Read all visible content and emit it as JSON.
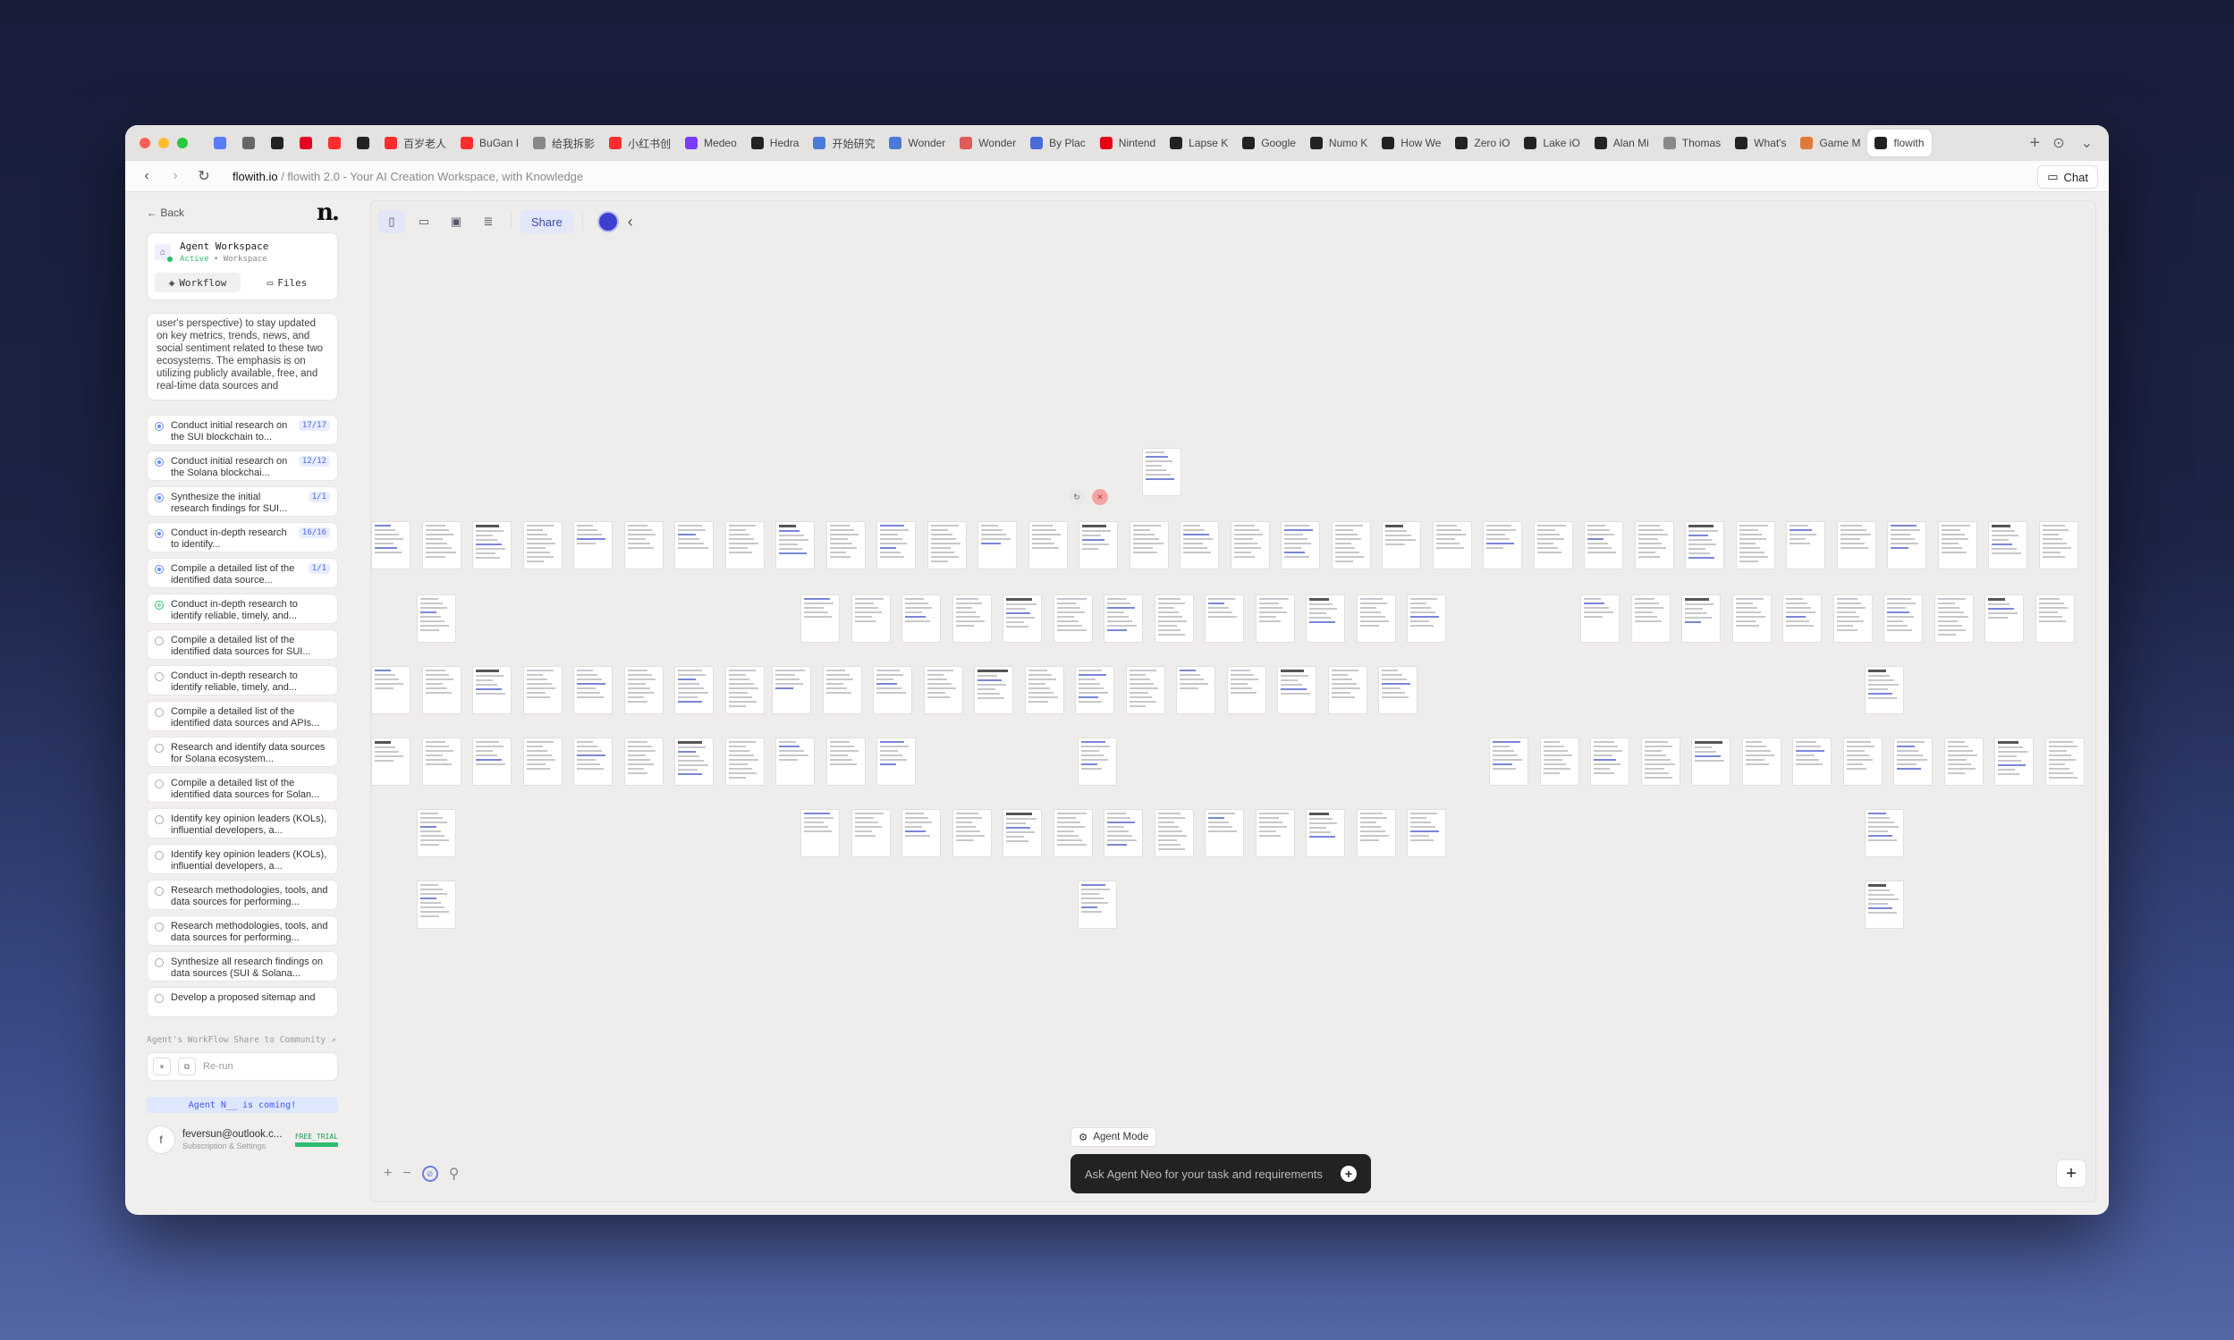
{
  "browser": {
    "tabs": [
      {
        "label": "",
        "icon": "sparkle-icon",
        "color": "#5a7cff"
      },
      {
        "label": "",
        "icon": "link-icon",
        "color": "#666666"
      },
      {
        "label": "",
        "icon": "cloud-icon",
        "color": "#222222"
      },
      {
        "label": "",
        "icon": "pinterest-icon",
        "color": "#e60023"
      },
      {
        "label": "",
        "icon": "youtube-icon",
        "color": "#ff2d2d"
      },
      {
        "label": "",
        "icon": "circle-icon",
        "color": "#222222"
      },
      {
        "label": "百岁老人",
        "icon": "youtube-icon",
        "color": "#ff2d2d"
      },
      {
        "label": "BuGan I",
        "icon": "youtube-icon",
        "color": "#ff2d2d"
      },
      {
        "label": "给我拆影",
        "icon": "chat-icon",
        "color": "#888888"
      },
      {
        "label": "小红书创",
        "icon": "youtube-icon",
        "color": "#ff2d2d"
      },
      {
        "label": "Medeo",
        "icon": "medeo-icon",
        "color": "#7a3cff"
      },
      {
        "label": "Hedra",
        "icon": "hedra-icon",
        "color": "#222222"
      },
      {
        "label": "开始研究",
        "icon": "doc-icon",
        "color": "#4a7bd8"
      },
      {
        "label": "Wonder",
        "icon": "doc-icon",
        "color": "#4a7bd8"
      },
      {
        "label": "Wonder",
        "icon": "w-icon",
        "color": "#e05a5a"
      },
      {
        "label": "By Plac",
        "icon": "bp-icon",
        "color": "#4a6cd8"
      },
      {
        "label": "Nintend",
        "icon": "nintendo-icon",
        "color": "#e60012"
      },
      {
        "label": "Lapse K",
        "icon": "cloud-icon",
        "color": "#222222"
      },
      {
        "label": "Google",
        "icon": "cloud-icon",
        "color": "#222222"
      },
      {
        "label": "Numo K",
        "icon": "cloud-icon",
        "color": "#222222"
      },
      {
        "label": "How We",
        "icon": "cloud-icon",
        "color": "#222222"
      },
      {
        "label": "Zero iO",
        "icon": "cloud-icon",
        "color": "#222222"
      },
      {
        "label": "Lake iO",
        "icon": "cloud-icon",
        "color": "#222222"
      },
      {
        "label": "Alan Mi",
        "icon": "cloud-icon",
        "color": "#222222"
      },
      {
        "label": "Thomas",
        "icon": "globe-icon",
        "color": "#888888"
      },
      {
        "label": "What's",
        "icon": "nyt-icon",
        "color": "#222222"
      },
      {
        "label": "Game M",
        "icon": "game-icon",
        "color": "#e07a3a"
      },
      {
        "label": "flowith",
        "icon": "flowith-icon",
        "color": "#222222",
        "active": true
      }
    ],
    "url_host": "flowith.io",
    "url_rest": " / flowith 2.0 - Your AI Creation Workspace, with Knowledge",
    "chat_label": "Chat"
  },
  "sidebar": {
    "back_label": "Back",
    "logo": "n.",
    "workspace_title": "Agent Workspace",
    "workspace_status_active": "Active",
    "workspace_status_rest": " • Workspace",
    "tab_workflow": "Workflow",
    "tab_files": "Files",
    "prompt_text": "user's perspective) to stay updated on key metrics, trends, news, and social sentiment related to these two ecosystems. The emphasis is on utilizing publicly available, free, and real-time data sources and",
    "steps": [
      {
        "text": "Conduct initial research on the SUI blockchain to...",
        "badge": "17/17",
        "state": "done"
      },
      {
        "text": "Conduct initial research on the Solana blockchai...",
        "badge": "12/12",
        "state": "done"
      },
      {
        "text": "Synthesize the initial research findings for SUI...",
        "badge": "1/1",
        "state": "done"
      },
      {
        "text": "Conduct in-depth research to identify...",
        "badge": "16/16",
        "state": "done"
      },
      {
        "text": "Compile a detailed list of the identified data source...",
        "badge": "1/1",
        "state": "done"
      },
      {
        "text": "Conduct in-depth research to identify reliable, timely, and...",
        "badge": "",
        "state": "running"
      },
      {
        "text": "Compile a detailed list of the identified data sources for SUI...",
        "badge": "",
        "state": "pending"
      },
      {
        "text": "Conduct in-depth research to identify reliable, timely, and...",
        "badge": "",
        "state": "pending"
      },
      {
        "text": "Compile a detailed list of the identified data sources and APIs...",
        "badge": "",
        "state": "pending"
      },
      {
        "text": "Research and identify data sources for Solana ecosystem...",
        "badge": "",
        "state": "pending"
      },
      {
        "text": "Compile a detailed list of the identified data sources for Solan...",
        "badge": "",
        "state": "pending"
      },
      {
        "text": "Identify key opinion leaders (KOLs), influential developers, a...",
        "badge": "",
        "state": "pending"
      },
      {
        "text": "Identify key opinion leaders (KOLs), influential developers, a...",
        "badge": "",
        "state": "pending"
      },
      {
        "text": "Research methodologies, tools, and data sources for performing...",
        "badge": "",
        "state": "pending"
      },
      {
        "text": "Research methodologies, tools, and data sources for performing...",
        "badge": "",
        "state": "pending"
      },
      {
        "text": "Synthesize all research findings on data sources (SUI & Solana...",
        "badge": "",
        "state": "pending"
      },
      {
        "text": "Develop a proposed sitemap and",
        "badge": "",
        "state": "pending"
      }
    ],
    "community_label": "Agent's WorkFlow Share to Community ↗",
    "rerun_label": "Re-run",
    "coming_label": "Agent N__ is coming!",
    "user_initial": "f",
    "user_email": "feversun@outlook.c...",
    "user_sub": "Subscription & Settings",
    "trial_badge": "FREE_TRIAL"
  },
  "canvas": {
    "share_label": "Share",
    "agent_mode_label": "Agent Mode",
    "ask_placeholder": "Ask Agent Neo for your task and requirements"
  }
}
